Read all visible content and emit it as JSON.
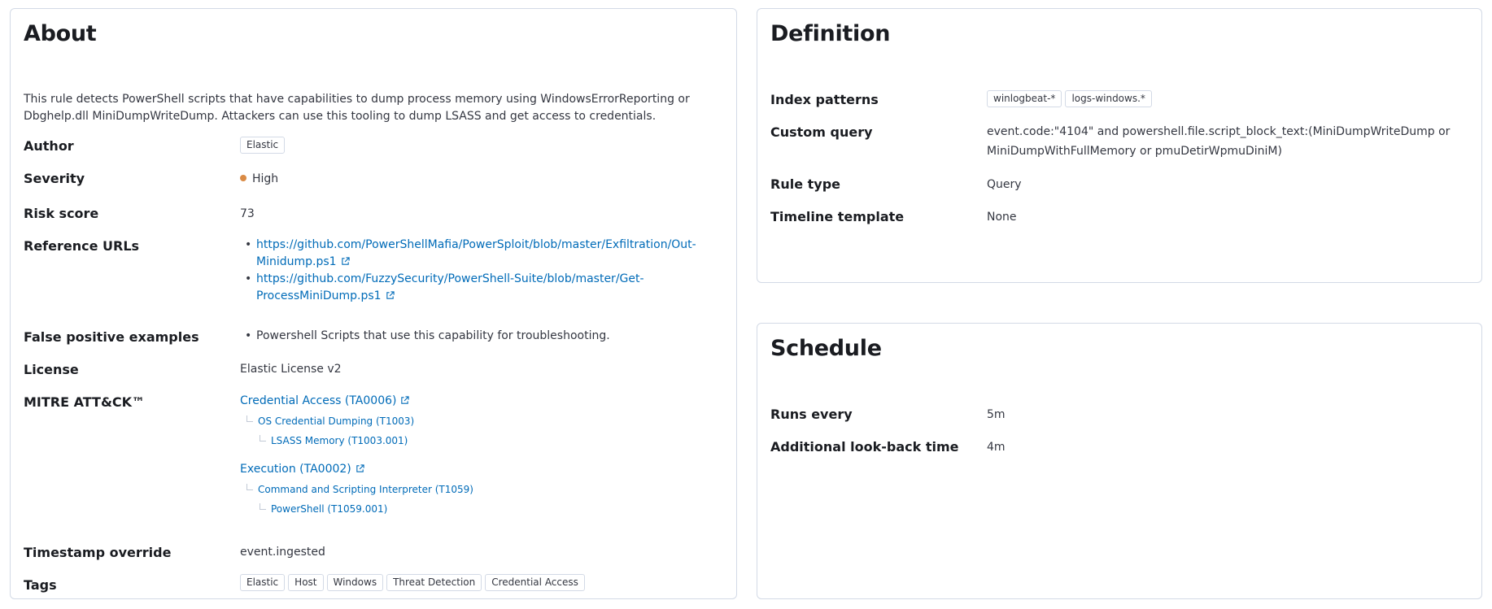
{
  "about": {
    "title": "About",
    "description": "This rule detects PowerShell scripts that have capabilities to dump process memory using WindowsErrorReporting or Dbghelp.dll MiniDumpWriteDump. Attackers can use this tooling to dump LSASS and get access to credentials.",
    "author_label": "Author",
    "author": "Elastic",
    "severity_label": "Severity",
    "severity": "High",
    "severity_color": "#da8b45",
    "risk_score_label": "Risk score",
    "risk_score": "73",
    "reference_urls_label": "Reference URLs",
    "reference_urls": [
      {
        "line1": "https://github.com/PowerShellMafia/PowerSploit/blob/master/Exfiltration/Out-",
        "line2": "Minidump.ps1"
      },
      {
        "line1": "https://github.com/FuzzySecurity/PowerShell-Suite/blob/master/Get-",
        "line2": "ProcessMiniDump.ps1"
      }
    ],
    "false_positive_label": "False positive examples",
    "false_positives": [
      "Powershell Scripts that use this capability for troubleshooting."
    ],
    "license_label": "License",
    "license": "Elastic License v2",
    "mitre_label": "MITRE ATT&CK™",
    "mitre": [
      {
        "tactic": "Credential Access (TA0006)",
        "technique": "OS Credential Dumping (T1003)",
        "subtechnique": "LSASS Memory (T1003.001)"
      },
      {
        "tactic": "Execution (TA0002)",
        "technique": "Command and Scripting Interpreter (T1059)",
        "subtechnique": "PowerShell (T1059.001)"
      }
    ],
    "timestamp_override_label": "Timestamp override",
    "timestamp_override": "event.ingested",
    "tags_label": "Tags",
    "tags": [
      "Elastic",
      "Host",
      "Windows",
      "Threat Detection",
      "Credential Access"
    ]
  },
  "definition": {
    "title": "Definition",
    "index_patterns_label": "Index patterns",
    "index_patterns": [
      "winlogbeat-*",
      "logs-windows.*"
    ],
    "custom_query_label": "Custom query",
    "custom_query_line1": "event.code:\"4104\" and powershell.file.script_block_text:(MiniDumpWriteDump or",
    "custom_query_line2": "MiniDumpWithFullMemory or pmuDetirWpmuDiniM)",
    "rule_type_label": "Rule type",
    "rule_type": "Query",
    "timeline_template_label": "Timeline template",
    "timeline_template": "None"
  },
  "schedule": {
    "title": "Schedule",
    "runs_every_label": "Runs every",
    "runs_every": "5m",
    "lookback_label": "Additional look-back time",
    "lookback": "4m"
  },
  "icons": {
    "external_link": "external-link-icon",
    "severity_dot": "severity-dot-icon"
  },
  "colors": {
    "link": "#006bb8",
    "border": "#d3dae6",
    "heading": "#1a1c21"
  }
}
